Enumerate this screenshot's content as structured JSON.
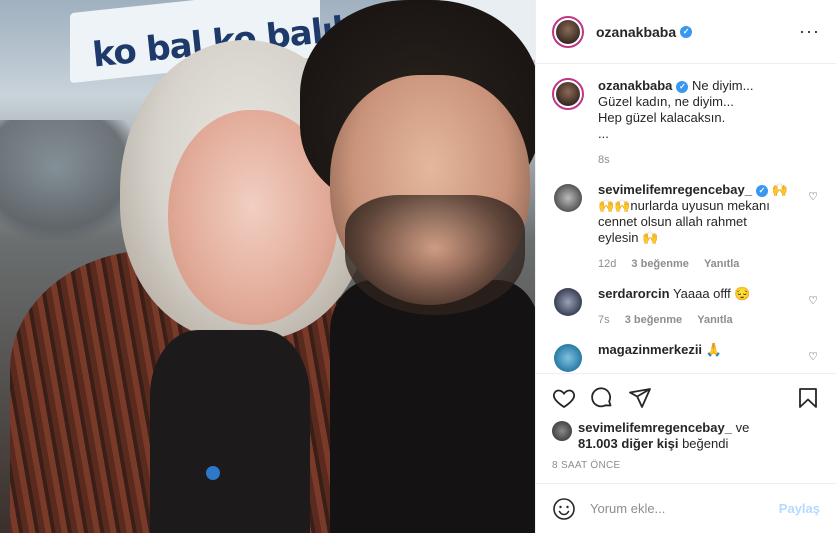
{
  "photo": {
    "sign_text": "ko bal  ko balık",
    "alt_icon": "photo-people"
  },
  "header": {
    "username": "ozanakbaba",
    "verified": true,
    "more_icon": "more-horizontal-icon"
  },
  "caption": {
    "username": "ozanakbaba",
    "lines": [
      "Ne diyim...",
      "Güzel kadın, ne diyim...",
      "Hep güzel kalacaksın.",
      "..."
    ],
    "time": "8s"
  },
  "comments": [
    {
      "username": "sevimelifemregencebay_",
      "text_lines": [
        "🙌",
        "🙌🙌nurlarda uyusun mekanı",
        "cennet olsun allah rahmet",
        "eylesin 🙌"
      ],
      "time": "12d",
      "likes": "3 beğenme",
      "reply": "Yanıtla"
    },
    {
      "username": "serdarorcin",
      "text": "Yaaaa offf 😔",
      "time": "7s",
      "likes": "3 beğenme",
      "reply": "Yanıtla"
    },
    {
      "username": "magazinmerkezii",
      "text": "🙏"
    }
  ],
  "likes": {
    "first_user": "sevimelifemregencebay_",
    "and": "ve",
    "count_text": "81.003 diğer kişi",
    "suffix": "beğendi"
  },
  "post_time": "8 SAAT ÖNCE",
  "add_comment": {
    "placeholder": "Yorum ekle...",
    "share_label": "Paylaş"
  },
  "colors": {
    "verified": "#3897f0",
    "story_ring": "#c13584",
    "share_disabled": "#b3dbff"
  }
}
